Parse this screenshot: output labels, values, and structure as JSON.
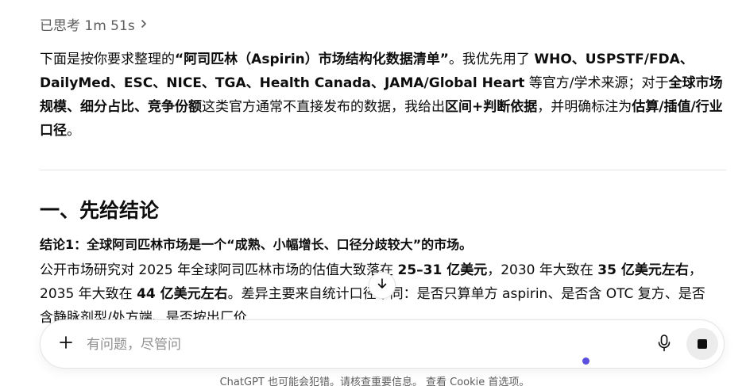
{
  "thinking": {
    "label": "已思考 1m 51s",
    "icon": "chevron-right-icon"
  },
  "intro": {
    "t1": "下面是按你要求整理的",
    "b1": "“阿司匹林（Aspirin）市场结构化数据清单”",
    "t2": "。我优先用了 ",
    "b2": "WHO、USPSTF/FDA、DailyMed、ESC、NICE、TGA、Health Canada、JAMA/Global Heart",
    "t3": " 等官方/学术来源；对于",
    "b3": "全球市场规模、细分占比、竞争份额",
    "t4": "这类官方通常不直接发布的数据，我给出",
    "b4": "区间+判断依据",
    "t5": "，并明确标注为",
    "b5": "估算/插值/行业口径",
    "t6": "。"
  },
  "section": {
    "heading": "一、先给结论",
    "conclusion_title": "结论1：全球阿司匹林市场是一个“成熟、小幅增长、口径分歧较大”的市场。",
    "body": {
      "t1": "公开市场研究对 2025 年全球阿司匹林市场的估值大致落在 ",
      "b1": "25–31 亿美元",
      "t2": "，2030 年大致在 ",
      "b2": "35 亿美元左右",
      "t3": "，2035 年大致在 ",
      "b3": "44 亿美元左右",
      "t4": "。差异主要来自统计口径不同：是否只算单方 aspirin、是否含 OTC 复方、是否含静脉剂型/处方端、是否按出厂价..."
    }
  },
  "scroll_button": {
    "icon": "arrow-down-icon"
  },
  "composer": {
    "placeholder": "有问题，尽管问",
    "plus_icon": "plus-icon",
    "mic_icon": "microphone-icon",
    "stop_icon": "stop-icon"
  },
  "footer": {
    "disclaimer": "ChatGPT 也可能会犯错。请核查重要信息。",
    "cookie_link": "查看 Cookie 首选项",
    "cookie_suffix": "。"
  },
  "colors": {
    "text": "#0d0d0d",
    "muted": "#5d5d5d",
    "placeholder": "#8f8f8f",
    "divider": "#e5e5e5",
    "stop_bg": "#ececec",
    "status_dot": "#5b4fe0"
  }
}
